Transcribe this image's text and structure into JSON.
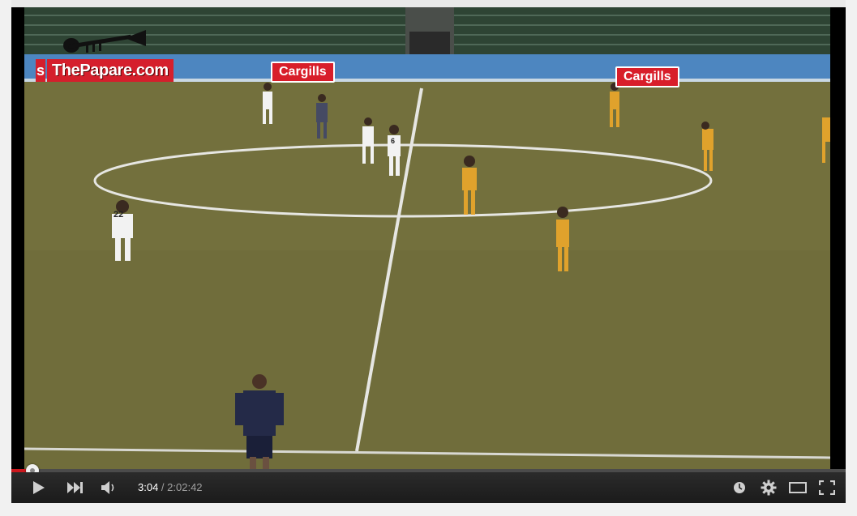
{
  "video": {
    "watermark": "ThePapare.com",
    "watermark_fragment": "s",
    "ad_boards": [
      "Cargills",
      "Cargills"
    ],
    "jersey_numbers": [
      "22",
      "6"
    ]
  },
  "player": {
    "current_time": "3:04",
    "separator": " / ",
    "duration": "2:02:42",
    "progress_fraction": 0.025,
    "accent_color": "#cc181e"
  },
  "controls": {
    "play_icon": "play-icon",
    "next_icon": "next-icon",
    "volume_icon": "volume-icon",
    "watch_later_icon": "clock-icon",
    "settings_icon": "gear-icon",
    "theater_icon": "theater-mode-icon",
    "fullscreen_icon": "fullscreen-icon"
  }
}
